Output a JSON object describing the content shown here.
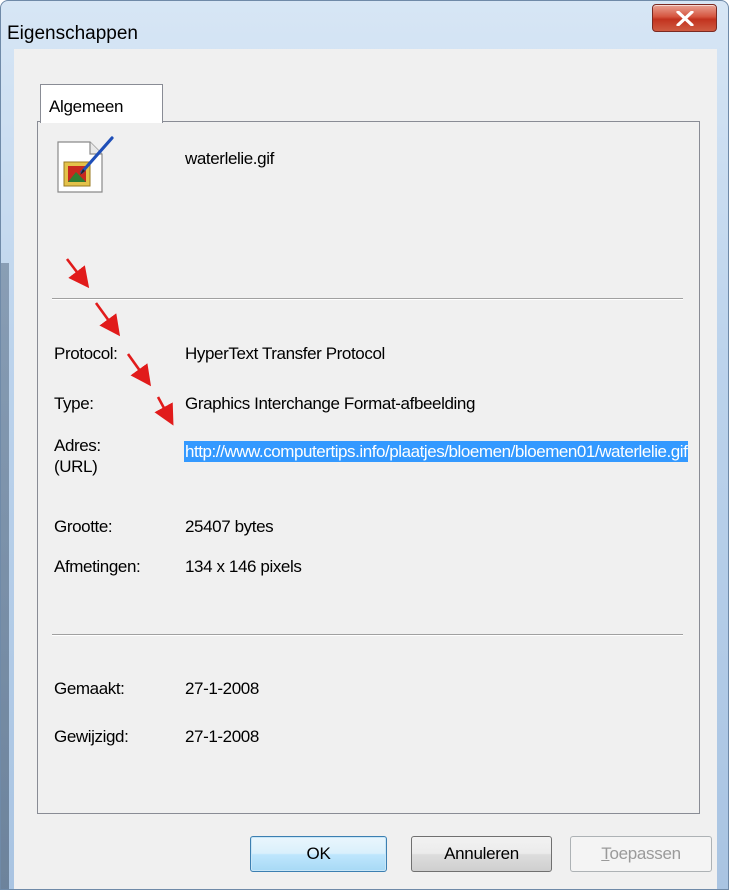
{
  "window": {
    "title": "Eigenschappen",
    "close_glyph": "✕"
  },
  "tabs": [
    {
      "label": "Algemeen"
    }
  ],
  "file": {
    "icon": "gif-file-icon",
    "name": "waterlelie.gif"
  },
  "properties": {
    "protocol": {
      "label": "Protocol:",
      "value": "HyperText Transfer Protocol"
    },
    "type": {
      "label": "Type:",
      "value": "Graphics Interchange Format-afbeelding"
    },
    "address": {
      "label_line1": "Adres:",
      "label_line2": "(URL)",
      "value": "http://www.computertips.info/plaatjes/bloemen/bloemen01/waterlelie.gif"
    },
    "size": {
      "label": "Grootte:",
      "value": "25407 bytes"
    },
    "dimensions": {
      "label": "Afmetingen:",
      "value": "134 x 146 pixels"
    },
    "created": {
      "label": "Gemaakt:",
      "value": "27-1-2008"
    },
    "modified": {
      "label": "Gewijzigd:",
      "value": "27-1-2008"
    }
  },
  "buttons": {
    "ok": "OK",
    "cancel": "Annuleren",
    "apply_mnemonic": "T",
    "apply_rest": "oepassen"
  },
  "colors": {
    "selection": "#3399ff",
    "arrows": "#e11b1b",
    "close_button": "#c2331f"
  }
}
